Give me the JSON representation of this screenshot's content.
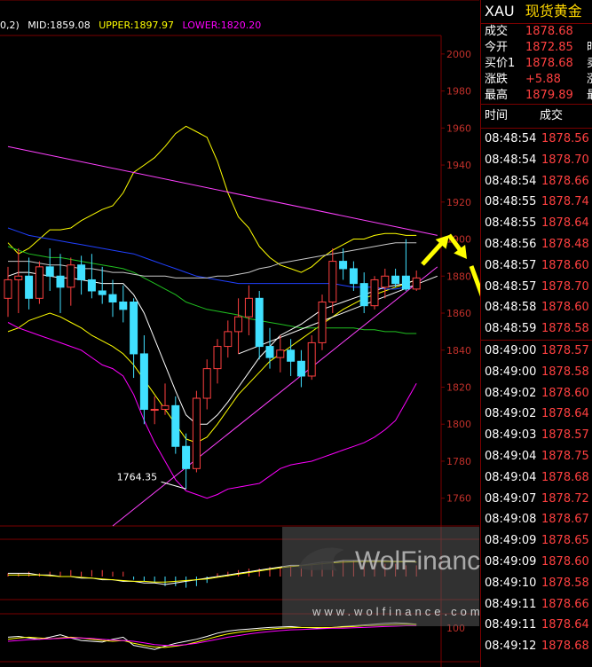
{
  "indicator_bar": {
    "prefix": "0,2)",
    "mid": "MID:1859.08",
    "upper": "UPPER:1897.97",
    "lower": "LOWER:1820.20"
  },
  "panel": {
    "symbol": "XAU",
    "name": "现货黄金",
    "quotes": [
      {
        "label": "成交",
        "value": "1878.68",
        "extra": ""
      },
      {
        "label": "今开",
        "value": "1872.85",
        "extra": "时"
      },
      {
        "label": "买价1",
        "value": "1878.68",
        "extra": "卖"
      },
      {
        "label": "涨跌",
        "value": "+5.88",
        "extra": "涨"
      },
      {
        "label": "最高",
        "value": "1879.89",
        "extra": "最"
      }
    ],
    "trades_header": {
      "time": "时间",
      "price": "成交"
    },
    "trades": [
      {
        "time": "08:48:54",
        "price": "1878.56"
      },
      {
        "time": "08:48:54",
        "price": "1878.70"
      },
      {
        "time": "08:48:54",
        "price": "1878.66"
      },
      {
        "time": "08:48:55",
        "price": "1878.74"
      },
      {
        "time": "08:48:55",
        "price": "1878.64"
      },
      {
        "time": "08:48:56",
        "price": "1878.48"
      },
      {
        "time": "08:48:57",
        "price": "1878.60"
      },
      {
        "time": "08:48:57",
        "price": "1878.70"
      },
      {
        "time": "08:48:58",
        "price": "1878.60"
      },
      {
        "time": "08:48:59",
        "price": "1878.58"
      },
      {
        "time": "08:49:00",
        "price": "1878.57"
      },
      {
        "time": "08:49:00",
        "price": "1878.58"
      },
      {
        "time": "08:49:02",
        "price": "1878.60"
      },
      {
        "time": "08:49:02",
        "price": "1878.64"
      },
      {
        "time": "08:49:03",
        "price": "1878.57"
      },
      {
        "time": "08:49:04",
        "price": "1878.75"
      },
      {
        "time": "08:49:04",
        "price": "1878.68"
      },
      {
        "time": "08:49:07",
        "price": "1878.72"
      },
      {
        "time": "08:49:08",
        "price": "1878.67"
      },
      {
        "time": "08:49:09",
        "price": "1878.65"
      },
      {
        "time": "08:49:09",
        "price": "1878.60"
      },
      {
        "time": "08:49:10",
        "price": "1878.58"
      },
      {
        "time": "08:49:11",
        "price": "1878.66"
      },
      {
        "time": "08:49:11",
        "price": "1878.64"
      },
      {
        "time": "08:49:12",
        "price": "1878.68"
      }
    ]
  },
  "watermark": {
    "logo": "WolFinance",
    "url": "www.wolfinance.com"
  },
  "colors": {
    "background": "#000000",
    "frame": "#7a0000",
    "axis_text": "#c0302a",
    "up": "#ff4040",
    "down": "#40e0ff",
    "mid": "#ffffff",
    "upper": "#ffff00",
    "lower": "#ff00ff",
    "quote_value": "#ff4040",
    "annotation_arrow": "#ffff00"
  },
  "chart_data": {
    "type": "candlestick",
    "ylim": [
      1745,
      2010
    ],
    "yticks": [
      1760,
      1780,
      1800,
      1820,
      1840,
      1860,
      1880,
      1900,
      1920,
      1940,
      1960,
      1980,
      2000
    ],
    "annotation": "1764.35",
    "sub_tick": "100",
    "candles": [
      {
        "o": 1868,
        "h": 1885,
        "l": 1858,
        "c": 1878
      },
      {
        "o": 1878,
        "h": 1895,
        "l": 1860,
        "c": 1880
      },
      {
        "o": 1880,
        "h": 1890,
        "l": 1862,
        "c": 1868
      },
      {
        "o": 1868,
        "h": 1888,
        "l": 1865,
        "c": 1885
      },
      {
        "o": 1885,
        "h": 1895,
        "l": 1872,
        "c": 1880
      },
      {
        "o": 1880,
        "h": 1892,
        "l": 1860,
        "c": 1874
      },
      {
        "o": 1874,
        "h": 1890,
        "l": 1864,
        "c": 1886
      },
      {
        "o": 1886,
        "h": 1891,
        "l": 1870,
        "c": 1878
      },
      {
        "o": 1878,
        "h": 1892,
        "l": 1868,
        "c": 1872
      },
      {
        "o": 1872,
        "h": 1885,
        "l": 1865,
        "c": 1870
      },
      {
        "o": 1870,
        "h": 1878,
        "l": 1858,
        "c": 1866
      },
      {
        "o": 1866,
        "h": 1875,
        "l": 1855,
        "c": 1862
      },
      {
        "o": 1866,
        "h": 1868,
        "l": 1825,
        "c": 1838
      },
      {
        "o": 1838,
        "h": 1848,
        "l": 1800,
        "c": 1808
      },
      {
        "o": 1808,
        "h": 1815,
        "l": 1800,
        "c": 1808
      },
      {
        "o": 1808,
        "h": 1822,
        "l": 1805,
        "c": 1810
      },
      {
        "o": 1810,
        "h": 1815,
        "l": 1784,
        "c": 1788
      },
      {
        "o": 1788,
        "h": 1795,
        "l": 1765,
        "c": 1776
      },
      {
        "o": 1776,
        "h": 1818,
        "l": 1774,
        "c": 1814
      },
      {
        "o": 1814,
        "h": 1835,
        "l": 1808,
        "c": 1830
      },
      {
        "o": 1830,
        "h": 1846,
        "l": 1822,
        "c": 1842
      },
      {
        "o": 1842,
        "h": 1856,
        "l": 1836,
        "c": 1850
      },
      {
        "o": 1850,
        "h": 1868,
        "l": 1838,
        "c": 1858
      },
      {
        "o": 1858,
        "h": 1875,
        "l": 1848,
        "c": 1868
      },
      {
        "o": 1868,
        "h": 1872,
        "l": 1835,
        "c": 1842
      },
      {
        "o": 1842,
        "h": 1852,
        "l": 1830,
        "c": 1836
      },
      {
        "o": 1836,
        "h": 1848,
        "l": 1828,
        "c": 1840
      },
      {
        "o": 1840,
        "h": 1846,
        "l": 1826,
        "c": 1834
      },
      {
        "o": 1834,
        "h": 1840,
        "l": 1820,
        "c": 1826
      },
      {
        "o": 1826,
        "h": 1848,
        "l": 1824,
        "c": 1844
      },
      {
        "o": 1844,
        "h": 1870,
        "l": 1840,
        "c": 1866
      },
      {
        "o": 1866,
        "h": 1895,
        "l": 1860,
        "c": 1888
      },
      {
        "o": 1888,
        "h": 1895,
        "l": 1878,
        "c": 1884
      },
      {
        "o": 1884,
        "h": 1888,
        "l": 1872,
        "c": 1876
      },
      {
        "o": 1876,
        "h": 1882,
        "l": 1860,
        "c": 1864
      },
      {
        "o": 1864,
        "h": 1880,
        "l": 1862,
        "c": 1878
      },
      {
        "o": 1874,
        "h": 1884,
        "l": 1868,
        "c": 1880
      },
      {
        "o": 1880,
        "h": 1884,
        "l": 1874,
        "c": 1876
      },
      {
        "o": 1880,
        "h": 1900,
        "l": 1872,
        "c": 1873
      },
      {
        "o": 1873,
        "h": 1883,
        "l": 1872,
        "c": 1879
      }
    ],
    "series": [
      {
        "color": "#ffff00",
        "values": [
          1898,
          1892,
          1895,
          1900,
          1905,
          1905,
          1906,
          1910,
          1913,
          1916,
          1918,
          1925,
          1936,
          1940,
          1944,
          1950,
          1957,
          1961,
          1958,
          1955,
          1942,
          1925,
          1912,
          1906,
          1896,
          1890,
          1886,
          1884,
          1882,
          1885,
          1890,
          1894,
          1897,
          1900,
          1900,
          1902,
          1903,
          1903,
          1902,
          1902
        ]
      },
      {
        "color": "#ffff00",
        "values": [
          1850,
          1852,
          1856,
          1858,
          1860,
          1858,
          1855,
          1852,
          1848,
          1845,
          1842,
          1838,
          1832,
          1824,
          1816,
          1808,
          1800,
          1792,
          1790,
          1793,
          1800,
          1808,
          1816,
          1822,
          1828,
          1834,
          1838,
          1842,
          1846,
          1850,
          1854,
          1858,
          1862,
          1865,
          1868,
          1870,
          1872,
          1874,
          1876,
          1878
        ]
      },
      {
        "color": "#ff00ff",
        "values": [
          1855,
          1852,
          1850,
          1848,
          1846,
          1844,
          1842,
          1840,
          1836,
          1832,
          1830,
          1826,
          1816,
          1802,
          1790,
          1780,
          1770,
          1764,
          1762,
          1760,
          1762,
          1765,
          1766,
          1767,
          1768,
          1772,
          1776,
          1778,
          1779,
          1780,
          1782,
          1784,
          1786,
          1788,
          1790,
          1793,
          1797,
          1802,
          1812,
          1822
        ]
      },
      {
        "color": "#2040ff",
        "values": [
          1906,
          1904,
          1902,
          1901,
          1900,
          1899,
          1898,
          1897,
          1896,
          1895,
          1894,
          1893,
          1892,
          1890,
          1888,
          1886,
          1884,
          1882,
          1880,
          1879,
          1878,
          1877,
          1876,
          1876,
          1876,
          1876,
          1876,
          1876,
          1876,
          1876,
          1876,
          1876,
          1875,
          1874,
          1874,
          1874,
          1873,
          1873,
          1874,
          1875
        ]
      },
      {
        "color": "#20c020",
        "values": [
          1896,
          1894,
          1892,
          1891,
          1890,
          1890,
          1889,
          1888,
          1887,
          1886,
          1885,
          1884,
          1882,
          1879,
          1876,
          1873,
          1870,
          1866,
          1864,
          1862,
          1861,
          1860,
          1859,
          1857,
          1856,
          1855,
          1854,
          1853,
          1852,
          1852,
          1852,
          1852,
          1852,
          1852,
          1851,
          1851,
          1850,
          1850,
          1849,
          1849
        ]
      },
      {
        "color": "#ffffff",
        "values": [
          1880,
          1882,
          1882,
          1881,
          1880,
          1879,
          1879,
          1878,
          1877,
          1876,
          1876,
          1876,
          1870,
          1860,
          1846,
          1832,
          1818,
          1805,
          1800,
          1800,
          1805,
          1812,
          1820,
          1828,
          1836,
          1842,
          1848,
          1851,
          1854,
          1858,
          1862,
          1864,
          1866,
          1868,
          1870,
          1872,
          1874,
          1875,
          1876,
          1878
        ]
      },
      {
        "color": "#c8c8c8",
        "values": [
          1888,
          1888,
          1888,
          1887,
          1886,
          1886,
          1885,
          1884,
          1884,
          1883,
          1882,
          1882,
          1881,
          1880,
          1880,
          1880,
          1879,
          1879,
          1879,
          1879,
          1880,
          1880,
          1881,
          1882,
          1884,
          1885,
          1887,
          1888,
          1889,
          1890,
          1891,
          1892,
          1893,
          1894,
          1895,
          1896,
          1897,
          1898,
          1898,
          1898
        ]
      }
    ],
    "trend_lines": [
      {
        "color": "#ff40ff",
        "from": [
          0,
          1950
        ],
        "to": [
          41,
          1902
        ]
      },
      {
        "color": "#ff40ff",
        "from": [
          10,
          1745
        ],
        "to": [
          41,
          1885
        ]
      },
      {
        "color": "#ffffff",
        "from": [
          22,
          1838
        ],
        "to": [
          41,
          1880
        ]
      }
    ],
    "sub_panel_1": {
      "bars": [
        0.2,
        0.2,
        0.3,
        0.2,
        0.3,
        0.3,
        0.4,
        0.3,
        0.4,
        0.4,
        0.3,
        0.3,
        -0.2,
        -0.3,
        -0.4,
        -0.6,
        -0.6,
        -0.7,
        -0.6,
        -0.4,
        0.2,
        0.3,
        0.4,
        0.5,
        0.5,
        0.6,
        0.6,
        0.7,
        0.7,
        0.8,
        0.9,
        1.0,
        1.0,
        1.0,
        0.9,
        0.9,
        0.8,
        0.8,
        0.7,
        0.7
      ],
      "line1": [
        0.2,
        0.2,
        0.2,
        0.1,
        0.1,
        0.0,
        0.0,
        -0.1,
        -0.1,
        -0.2,
        -0.2,
        -0.3,
        -0.3,
        -0.4,
        -0.4,
        -0.5,
        -0.4,
        -0.3,
        -0.2,
        -0.1,
        0.0,
        0.1,
        0.2,
        0.3,
        0.4,
        0.5,
        0.6,
        0.7,
        0.7,
        0.8,
        0.9,
        0.9,
        1.0,
        1.0,
        1.0,
        1.0,
        1.0,
        0.95,
        0.95,
        0.9
      ],
      "line2": [
        0.1,
        0.1,
        0.1,
        0.1,
        0.05,
        0.0,
        0.0,
        -0.05,
        -0.1,
        -0.15,
        -0.2,
        -0.25,
        -0.3,
        -0.3,
        -0.35,
        -0.35,
        -0.3,
        -0.25,
        -0.2,
        -0.15,
        -0.05,
        0.05,
        0.15,
        0.25,
        0.35,
        0.45,
        0.55,
        0.62,
        0.68,
        0.74,
        0.8,
        0.86,
        0.9,
        0.92,
        0.94,
        0.94,
        0.94,
        0.93,
        0.92,
        0.91
      ]
    },
    "sub_panel_2": {
      "white": [
        60,
        62,
        58,
        55,
        60,
        66,
        58,
        52,
        50,
        48,
        55,
        60,
        40,
        35,
        30,
        38,
        45,
        50,
        55,
        62,
        70,
        75,
        78,
        80,
        82,
        84,
        85,
        86,
        84,
        83,
        82,
        84,
        86,
        88,
        90,
        92,
        94,
        95,
        94,
        92
      ],
      "yellow": [
        55,
        58,
        60,
        58,
        56,
        58,
        60,
        58,
        55,
        52,
        50,
        52,
        45,
        40,
        36,
        35,
        38,
        42,
        48,
        55,
        62,
        68,
        72,
        75,
        78,
        80,
        82,
        83,
        84,
        84,
        84,
        84,
        85,
        86,
        88,
        89,
        90,
        91,
        92,
        91
      ],
      "magenta": [
        50,
        52,
        54,
        55,
        56,
        57,
        58,
        58,
        57,
        55,
        53,
        52,
        50,
        46,
        42,
        40,
        40,
        42,
        45,
        50,
        55,
        60,
        64,
        68,
        71,
        74,
        76,
        78,
        79,
        80,
        81,
        82,
        82,
        83,
        84,
        85,
        86,
        87,
        88,
        88
      ]
    }
  }
}
